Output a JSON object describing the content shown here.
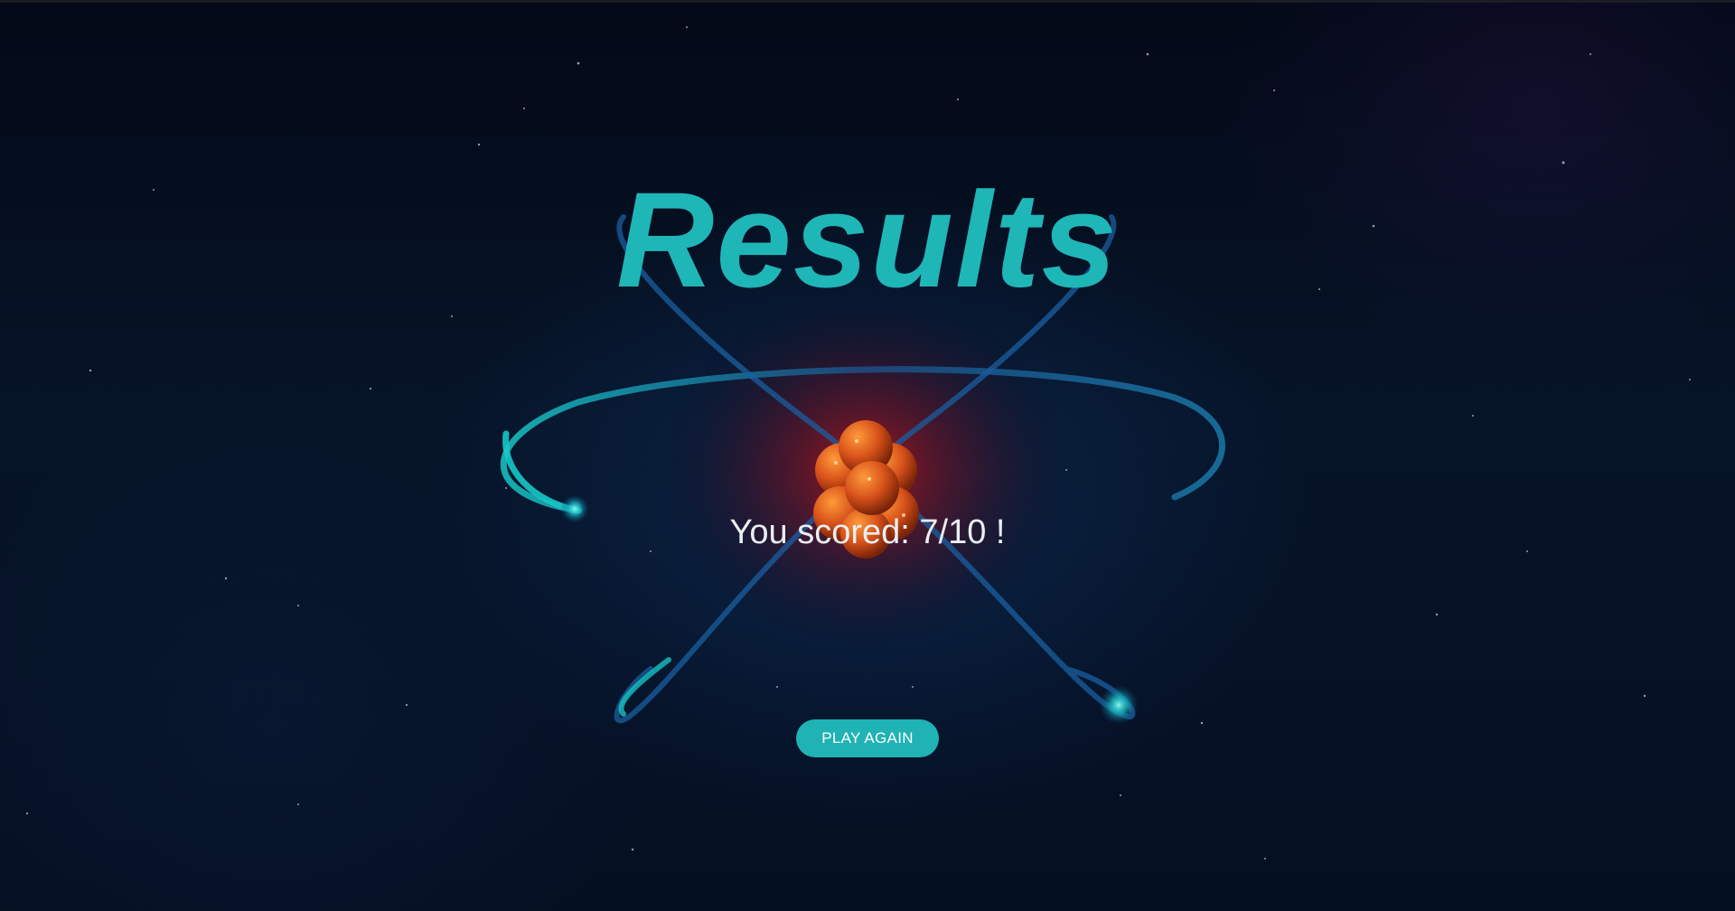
{
  "page": {
    "title": "Results",
    "score_text": "You scored: 7/10 !",
    "play_again_label": "PLAY AGAIN"
  },
  "theme": {
    "accent": "#1fb6b8",
    "background": "#040c1c",
    "text": "#e9eef2",
    "nucleus": "#d2511a"
  },
  "icons": {
    "atom": "atom-illustration"
  }
}
